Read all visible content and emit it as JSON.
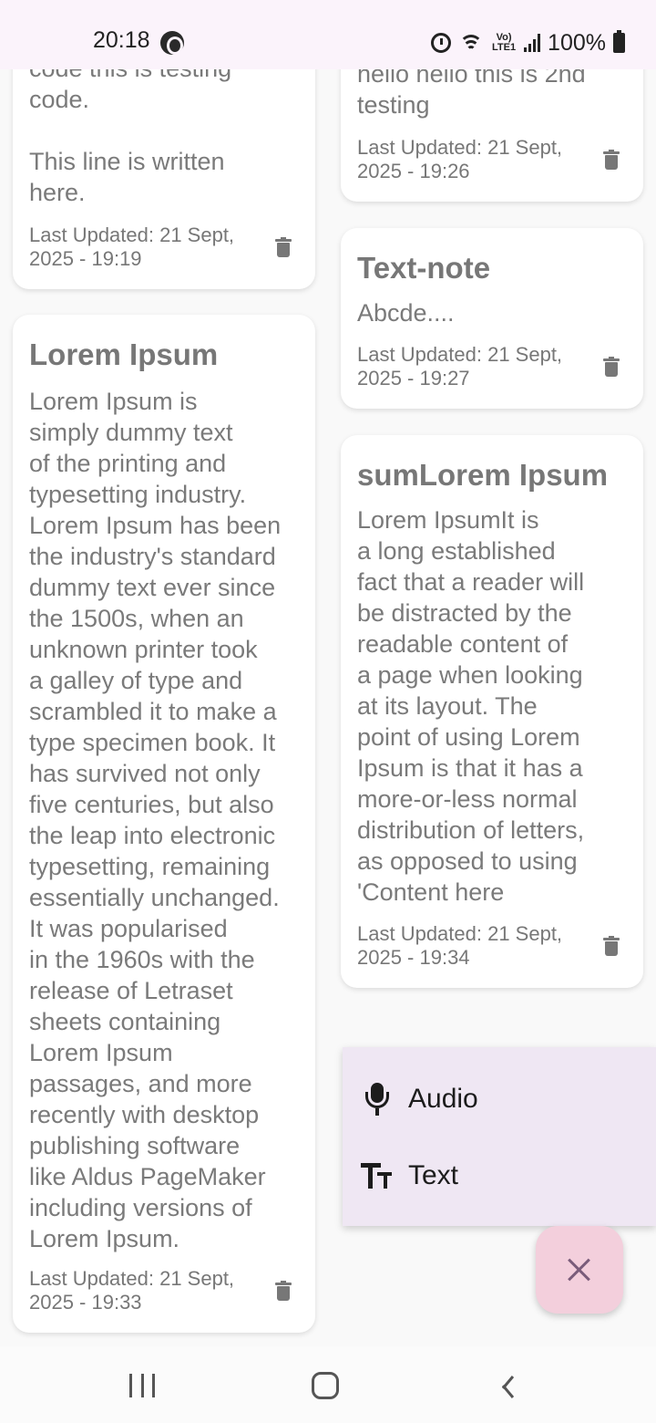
{
  "status_bar": {
    "time": "20:18",
    "battery_text": "100%",
    "network_label": "Vo) LTE1",
    "icons": [
      "messenger-icon",
      "alarm-icon",
      "wifi-icon",
      "lte-icon",
      "signal-icon",
      "battery-icon"
    ]
  },
  "notes": [
    {
      "title": "",
      "body": "code this is testing\ncode.\n\nThis line is written\nhere.",
      "updated": "Last Updated: 21 Sept, 2025 - 19:19"
    },
    {
      "title": "Lorem Ipsum",
      "body": "Lorem Ipsum is\nsimply dummy text\nof the printing and\ntypesetting industry.\nLorem Ipsum has been\nthe industry's standard\ndummy text ever since\nthe 1500s, when an\nunknown printer took\na galley of type and\nscrambled it to make a\ntype specimen book. It\nhas survived not only\nfive centuries, but also\nthe leap into electronic\ntypesetting, remaining\nessentially unchanged.\nIt was popularised\nin the 1960s with the\nrelease of Letraset\nsheets containing\nLorem Ipsum\npassages, and more\nrecently with desktop\npublishing software\nlike Aldus PageMaker\nincluding versions of\nLorem Ipsum.",
      "updated": "Last Updated: 21 Sept, 2025 - 19:33"
    },
    {
      "title": "",
      "body": "hello hello this is 2nd\ntesting",
      "updated": "Last Updated: 21 Sept, 2025 - 19:26"
    },
    {
      "title": "Text-note",
      "body": "Abcde....",
      "updated": "Last Updated: 21 Sept, 2025 - 19:27"
    },
    {
      "title": "sumLorem Ipsum",
      "body": "Lorem IpsumIt is\na long established\nfact that a reader will\nbe distracted by the\nreadable content of\na page when looking\nat its layout. The\npoint of using Lorem\nIpsum is that it has a\nmore-or-less normal\ndistribution of letters,\nas opposed to using\n'Content here",
      "updated": "Last Updated: 21 Sept, 2025 - 19:34"
    }
  ],
  "add_menu": {
    "items": [
      {
        "label": "Audio",
        "icon": "mic-icon"
      },
      {
        "label": "Text",
        "icon": "text-format-icon"
      }
    ]
  },
  "fab": {
    "icon": "close-icon"
  },
  "nav_bar": {
    "icons": [
      "recent-apps-icon",
      "home-icon",
      "back-icon"
    ]
  },
  "colors": {
    "status_bar_bg": "#fbf3fb",
    "card_bg": "#ffffff",
    "menu_bg": "#efe7f3",
    "fab_bg": "#f3cfdc",
    "fab_icon": "#7a5c7a",
    "text_muted": "#777777"
  }
}
